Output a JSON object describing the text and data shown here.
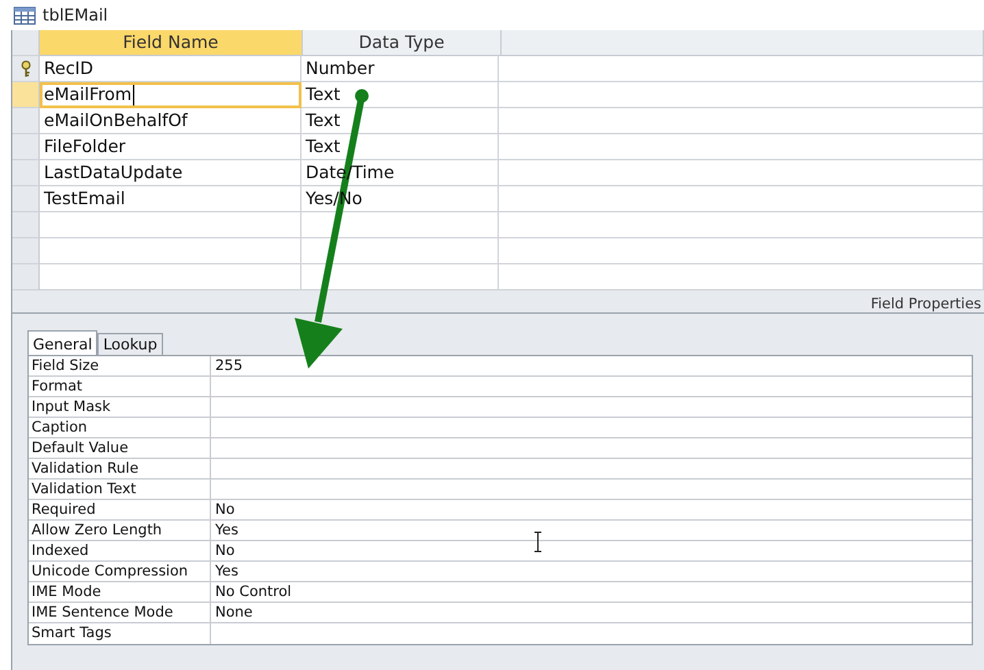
{
  "window": {
    "title": "tblEMail"
  },
  "grid": {
    "columns": [
      "Field Name",
      "Data Type"
    ],
    "rows": [
      {
        "field_name": "RecID",
        "data_type": "Number",
        "primary_key": true,
        "selected": false
      },
      {
        "field_name": "eMailFrom",
        "data_type": "Text",
        "primary_key": false,
        "selected": true
      },
      {
        "field_name": "eMailOnBehalfOf",
        "data_type": "Text",
        "primary_key": false,
        "selected": false
      },
      {
        "field_name": "FileFolder",
        "data_type": "Text",
        "primary_key": false,
        "selected": false
      },
      {
        "field_name": "LastDataUpdate",
        "data_type": "Date/Time",
        "primary_key": false,
        "selected": false
      },
      {
        "field_name": "TestEmail",
        "data_type": "Yes/No",
        "primary_key": false,
        "selected": false
      }
    ]
  },
  "field_properties": {
    "title": "Field Properties",
    "tabs": [
      {
        "label": "General",
        "selected": true
      },
      {
        "label": "Lookup",
        "selected": false
      }
    ],
    "properties": [
      {
        "label": "Field Size",
        "value": "255"
      },
      {
        "label": "Format"
      },
      {
        "label": "Input Mask"
      },
      {
        "label": "Caption"
      },
      {
        "label": "Default Value"
      },
      {
        "label": "Validation Rule"
      },
      {
        "label": "Validation Text"
      },
      {
        "label": "Required",
        "value": "No"
      },
      {
        "label": "Allow Zero Length",
        "value": "Yes"
      },
      {
        "label": "Indexed",
        "value": "No"
      },
      {
        "label": "Unicode Compression",
        "value": "Yes"
      },
      {
        "label": "IME Mode",
        "value": "No Control"
      },
      {
        "label": "IME Sentence Mode",
        "value": "None"
      },
      {
        "label": "Smart Tags"
      }
    ]
  }
}
